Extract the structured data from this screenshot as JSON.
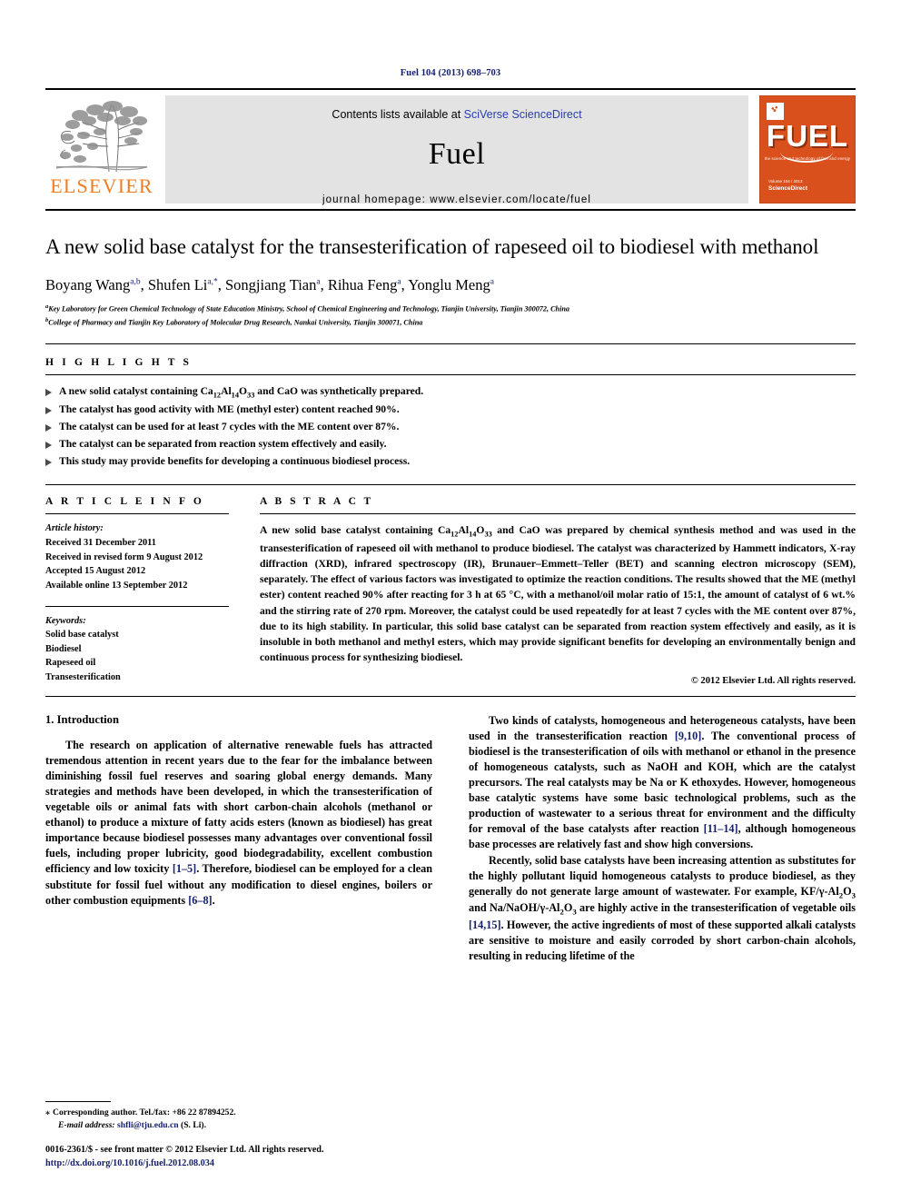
{
  "running_head": "Fuel 104 (2013) 698–703",
  "masthead": {
    "publisher_name": "ELSEVIER",
    "contents_prefix": "Contents lists available at ",
    "sciencedirect": "SciVerse ScienceDirect",
    "journal_title": "Fuel",
    "homepage": "journal homepage: www.elsevier.com/locate/fuel",
    "cover": {
      "brand": "FUEL",
      "tagline": "the science and technology of fuel and energy",
      "footer_line1": "Volume 104 / 2013",
      "footer_publisher": "ScienceDirect"
    }
  },
  "article": {
    "title": "A new solid base catalyst for the transesterification of rapeseed oil to biodiesel with methanol",
    "authors": [
      {
        "name": "Boyang Wang",
        "sup": "a,b",
        "sep": ", "
      },
      {
        "name": "Shufen Li",
        "sup": "a,*",
        "sep": ", "
      },
      {
        "name": "Songjiang Tian",
        "sup": "a",
        "sep": ", "
      },
      {
        "name": "Rihua Feng",
        "sup": "a",
        "sep": ", "
      },
      {
        "name": "Yonglu Meng",
        "sup": "a",
        "sep": ""
      }
    ],
    "affiliations": [
      {
        "sup": "a",
        "text": "Key Laboratory for Green Chemical Technology of State Education Ministry, School of Chemical Engineering and Technology, Tianjin University, Tianjin 300072, China"
      },
      {
        "sup": "b",
        "text": "College of Pharmacy and Tianjin Key Laboratory of Molecular Drug Research, Nankai University, Tianjin 300071, China"
      }
    ]
  },
  "highlights": {
    "heading": "H I G H L I G H T S",
    "items": [
      "A new solid catalyst containing Ca12Al14O33 and CaO was synthetically prepared.",
      "The catalyst has good activity with ME (methyl ester) content reached 90%.",
      "The catalyst can be used for at least 7 cycles with the ME content over 87%.",
      "The catalyst can be separated from reaction system effectively and easily.",
      "This study may provide benefits for developing a continuous biodiesel process."
    ]
  },
  "article_info": {
    "heading": "A R T I C L E    I N F O",
    "history_label": "Article history:",
    "history": [
      "Received 31 December 2011",
      "Received in revised form 9 August 2012",
      "Accepted 15 August 2012",
      "Available online 13 September 2012"
    ],
    "keywords_label": "Keywords:",
    "keywords": [
      "Solid base catalyst",
      "Biodiesel",
      "Rapeseed oil",
      "Transesterification"
    ]
  },
  "abstract": {
    "heading": "A B S T R A C T",
    "text": "A new solid base catalyst containing Ca12Al14O33 and CaO was prepared by chemical synthesis method and was used in the transesterification of rapeseed oil with methanol to produce biodiesel. The catalyst was characterized by Hammett indicators, X-ray diffraction (XRD), infrared spectroscopy (IR), Brunauer–Emmett–Teller (BET) and scanning electron microscopy (SEM), separately. The effect of various factors was investigated to optimize the reaction conditions. The results showed that the ME (methyl ester) content reached 90% after reacting for 3 h at 65 °C, with a methanol/oil molar ratio of 15:1, the amount of catalyst of 6 wt.% and the stirring rate of 270 rpm. Moreover, the catalyst could be used repeatedly for at least 7 cycles with the ME content over 87%, due to its high stability. In particular, this solid base catalyst can be separated from reaction system effectively and easily, as it is insoluble in both methanol and methyl esters, which may provide significant benefits for developing an environmentally benign and continuous process for synthesizing biodiesel.",
    "copyright": "© 2012 Elsevier Ltd. All rights reserved."
  },
  "body": {
    "section_heading": "1. Introduction",
    "left_paragraphs": [
      "The research on application of alternative renewable fuels has attracted tremendous attention in recent years due to the fear for the imbalance between diminishing fossil fuel reserves and soaring global energy demands. Many strategies and methods have been developed, in which the transesterification of vegetable oils or animal fats with short carbon-chain alcohols (methanol or ethanol) to produce a mixture of fatty acids esters (known as biodiesel) has great importance because biodiesel possesses many advantages over conventional fossil fuels, including proper lubricity, good biodegradability, excellent combustion efficiency and low toxicity [1–5]. Therefore, biodiesel can be employed for a clean substitute for fossil fuel without any modification to diesel engines, boilers or other combustion equipments [6–8]."
    ],
    "right_paragraphs": [
      "Two kinds of catalysts, homogeneous and heterogeneous catalysts, have been used in the transesterification reaction [9,10]. The conventional process of biodiesel is the transesterification of oils with methanol or ethanol in the presence of homogeneous catalysts, such as NaOH and KOH, which are the catalyst precursors. The real catalysts may be Na or K ethoxydes. However, homogeneous base catalytic systems have some basic technological problems, such as the production of wastewater to a serious threat for environment and the difficulty for removal of the base catalysts after reaction [11–14], although homogeneous base processes are relatively fast and show high conversions.",
      "Recently, solid base catalysts have been increasing attention as substitutes for the highly pollutant liquid homogeneous catalysts to produce biodiesel, as they generally do not generate large amount of wastewater. For example, KF/γ-Al2O3 and Na/NaOH/γ-Al2O3 are highly active in the transesterification of vegetable oils [14,15]. However, the active ingredients of most of these supported alkali catalysts are sensitive to moisture and easily corroded by short carbon-chain alcohols, resulting in reducing lifetime of the"
    ]
  },
  "footnote": {
    "star": "⁎",
    "corresponding": "Corresponding author. Tel./fax: +86 22 87894252.",
    "email_label": "E-mail address:",
    "email": "shfli@tju.edu.cn",
    "email_suffix": "(S. Li).",
    "issn_line": "0016-2361/$ - see front matter © 2012 Elsevier Ltd. All rights reserved.",
    "doi": "http://dx.doi.org/10.1016/j.fuel.2012.08.034"
  }
}
